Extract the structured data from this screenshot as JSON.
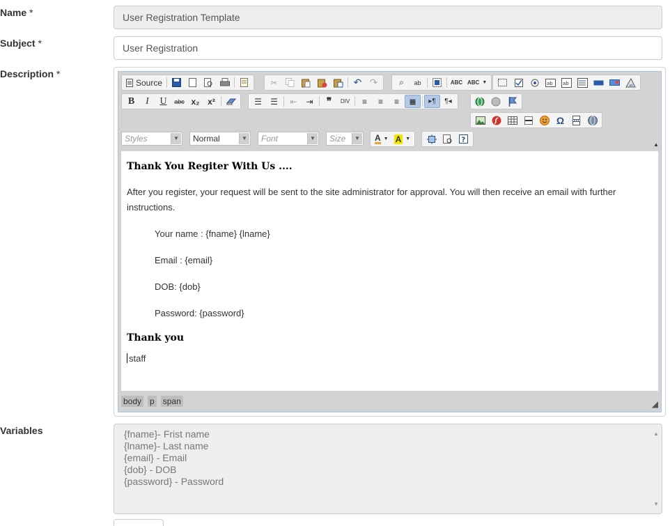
{
  "form": {
    "name_label": "Name",
    "subject_label": "Subject",
    "description_label": "Description",
    "variables_label": "Variables",
    "required_mark": "*",
    "name_value": "User Registration Template",
    "subject_value": "User Registration"
  },
  "toolbar": {
    "source_label": "Source",
    "styles_placeholder": "Styles",
    "format_value": "Normal",
    "font_placeholder": "Font",
    "size_placeholder": "Size",
    "subscript": "x₂",
    "superscript": "x²",
    "bold": "B",
    "italic": "I",
    "underline": "U",
    "strike": "abc"
  },
  "editor": {
    "heading": "Thank You Regiter With Us ....",
    "intro": "After you register, your request will be sent to the site administrator for approval. You will then receive an email with further instructions.",
    "fields": [
      "Your name : {fname} {lname}",
      "Email : {email}",
      "DOB: {dob}",
      "Password: {password}"
    ],
    "closing": "Thank you",
    "signature": "staff",
    "path": [
      "body",
      "p",
      "span"
    ]
  },
  "variables": [
    "{fname}- Frist name",
    "{lname}- Last name",
    "{email} - Email",
    "{dob} - DOB",
    "{password} - Password"
  ]
}
